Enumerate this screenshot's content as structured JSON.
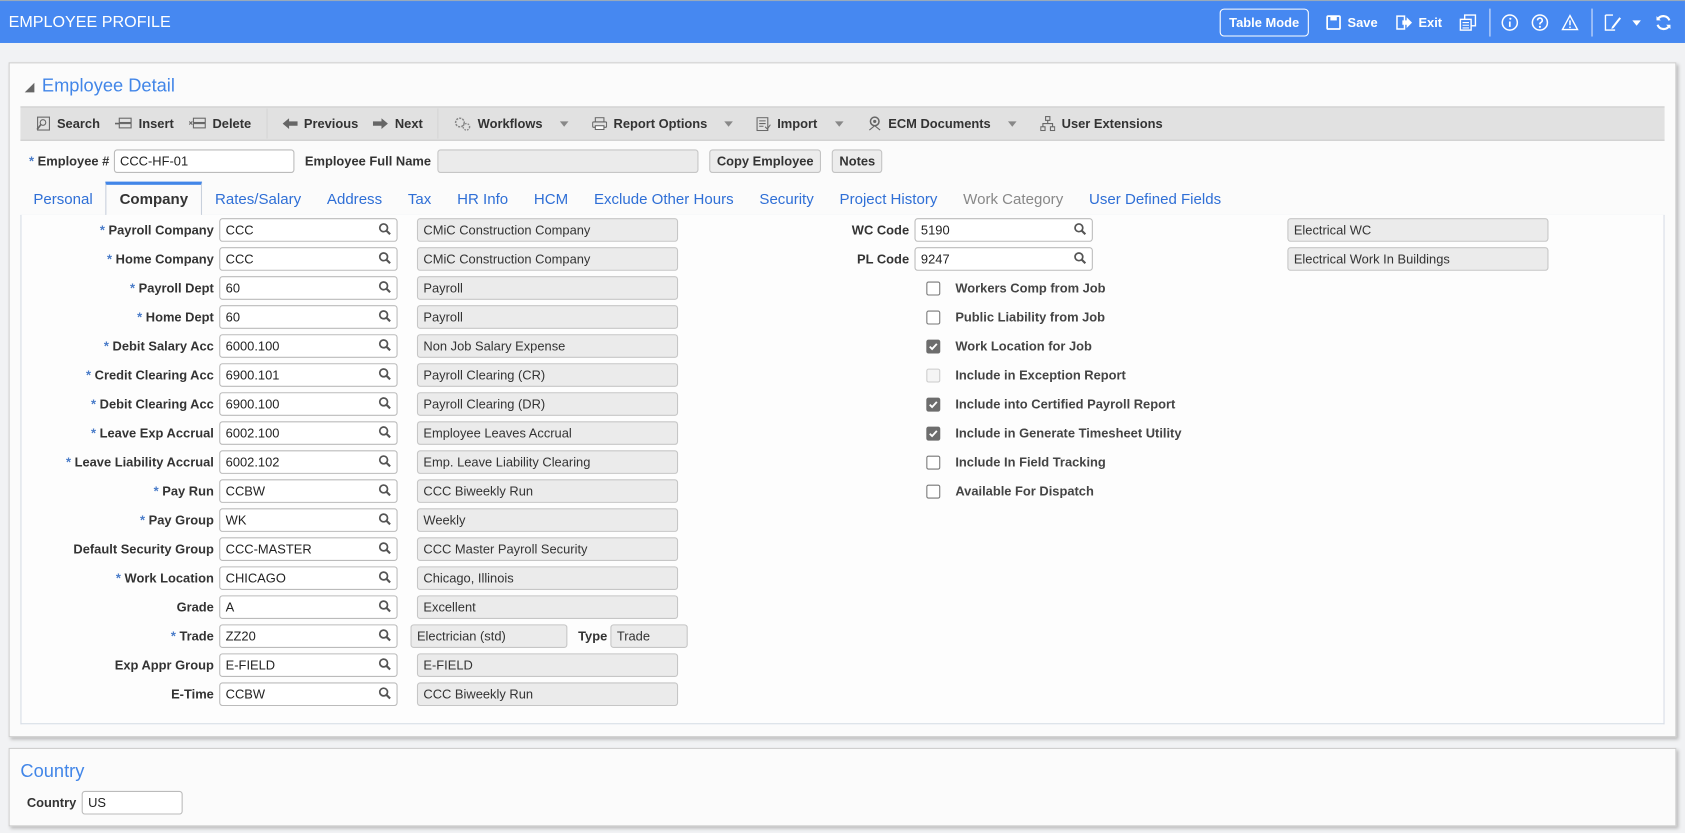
{
  "app": {
    "title": "EMPLOYEE PROFILE",
    "toolbar": {
      "table_mode": "Table Mode",
      "save": "Save",
      "exit": "Exit"
    }
  },
  "panel": {
    "title": "Employee Detail",
    "actions": {
      "search": "Search",
      "insert": "Insert",
      "delete": "Delete",
      "previous": "Previous",
      "next": "Next",
      "workflows": "Workflows",
      "report_options": "Report Options",
      "import": "Import",
      "ecm_documents": "ECM Documents",
      "user_extensions": "User Extensions"
    },
    "employee": {
      "number_label": "Employee #",
      "number_value": "CCC-HF-01",
      "full_name_label": "Employee Full Name",
      "full_name_value": "",
      "copy_button": "Copy Employee",
      "notes_button": "Notes"
    },
    "tabs": [
      {
        "label": "Personal"
      },
      {
        "label": "Company",
        "active": true
      },
      {
        "label": "Rates/Salary"
      },
      {
        "label": "Address"
      },
      {
        "label": "Tax"
      },
      {
        "label": "HR Info"
      },
      {
        "label": "HCM"
      },
      {
        "label": "Exclude Other Hours"
      },
      {
        "label": "Security"
      },
      {
        "label": "Project History"
      },
      {
        "label": "Work Category",
        "disabled": true
      },
      {
        "label": "User Defined Fields"
      }
    ],
    "fields": [
      {
        "label": "Payroll Company",
        "required": true,
        "value": "CCC",
        "desc": "CMiC Construction Company"
      },
      {
        "label": "Home Company",
        "required": true,
        "value": "CCC",
        "desc": "CMiC Construction Company"
      },
      {
        "label": "Payroll Dept",
        "required": true,
        "value": "60",
        "desc": "Payroll"
      },
      {
        "label": "Home Dept",
        "required": true,
        "value": "60",
        "desc": "Payroll"
      },
      {
        "label": "Debit Salary Acc",
        "required": true,
        "value": "6000.100",
        "desc": "Non Job Salary Expense"
      },
      {
        "label": "Credit Clearing Acc",
        "required": true,
        "value": "6900.101",
        "desc": "Payroll Clearing (CR)"
      },
      {
        "label": "Debit Clearing Acc",
        "required": true,
        "value": "6900.100",
        "desc": "Payroll Clearing (DR)"
      },
      {
        "label": "Leave Exp Accrual",
        "required": true,
        "value": "6002.100",
        "desc": "Employee Leaves Accrual"
      },
      {
        "label": "Leave Liability Accrual",
        "required": true,
        "value": "6002.102",
        "desc": "Emp. Leave Liability Clearing"
      },
      {
        "label": "Pay Run",
        "required": true,
        "value": "CCBW",
        "desc": "CCC Biweekly Run"
      },
      {
        "label": "Pay Group",
        "required": true,
        "value": "WK",
        "desc": "Weekly"
      },
      {
        "label": "Default Security Group",
        "required": false,
        "value": "CCC-MASTER",
        "desc": "CCC Master Payroll Security"
      },
      {
        "label": "Work Location",
        "required": true,
        "value": "CHICAGO",
        "desc": "Chicago, Illinois"
      },
      {
        "label": "Grade",
        "required": false,
        "value": "A",
        "desc": "Excellent"
      },
      {
        "label": "Trade",
        "required": true,
        "value": "ZZ20",
        "desc": "Electrician (std)",
        "type_label": "Type",
        "type_value": "Trade"
      },
      {
        "label": "Exp Appr Group",
        "required": false,
        "value": "E-FIELD",
        "desc": "E-FIELD"
      },
      {
        "label": "E-Time",
        "required": false,
        "value": "CCBW",
        "desc": "CCC Biweekly Run"
      }
    ],
    "right_fields": [
      {
        "label": "WC Code",
        "value": "5190",
        "desc": "Electrical WC"
      },
      {
        "label": "PL Code",
        "value": "9247",
        "desc": "Electrical Work In Buildings"
      }
    ],
    "checkboxes": [
      {
        "label": "Workers Comp from Job",
        "checked": false
      },
      {
        "label": "Public Liability from Job",
        "checked": false
      },
      {
        "label": "Work Location for Job",
        "checked": true
      },
      {
        "label": "Include in Exception Report",
        "checked": false,
        "disabled": true
      },
      {
        "label": "Include into Certified Payroll Report",
        "checked": true
      },
      {
        "label": "Include in Generate Timesheet Utility",
        "checked": true
      },
      {
        "label": "Include In Field Tracking",
        "checked": false
      },
      {
        "label": "Available For Dispatch",
        "checked": false
      }
    ]
  },
  "country_panel": {
    "title": "Country",
    "label": "Country",
    "value": "US"
  }
}
